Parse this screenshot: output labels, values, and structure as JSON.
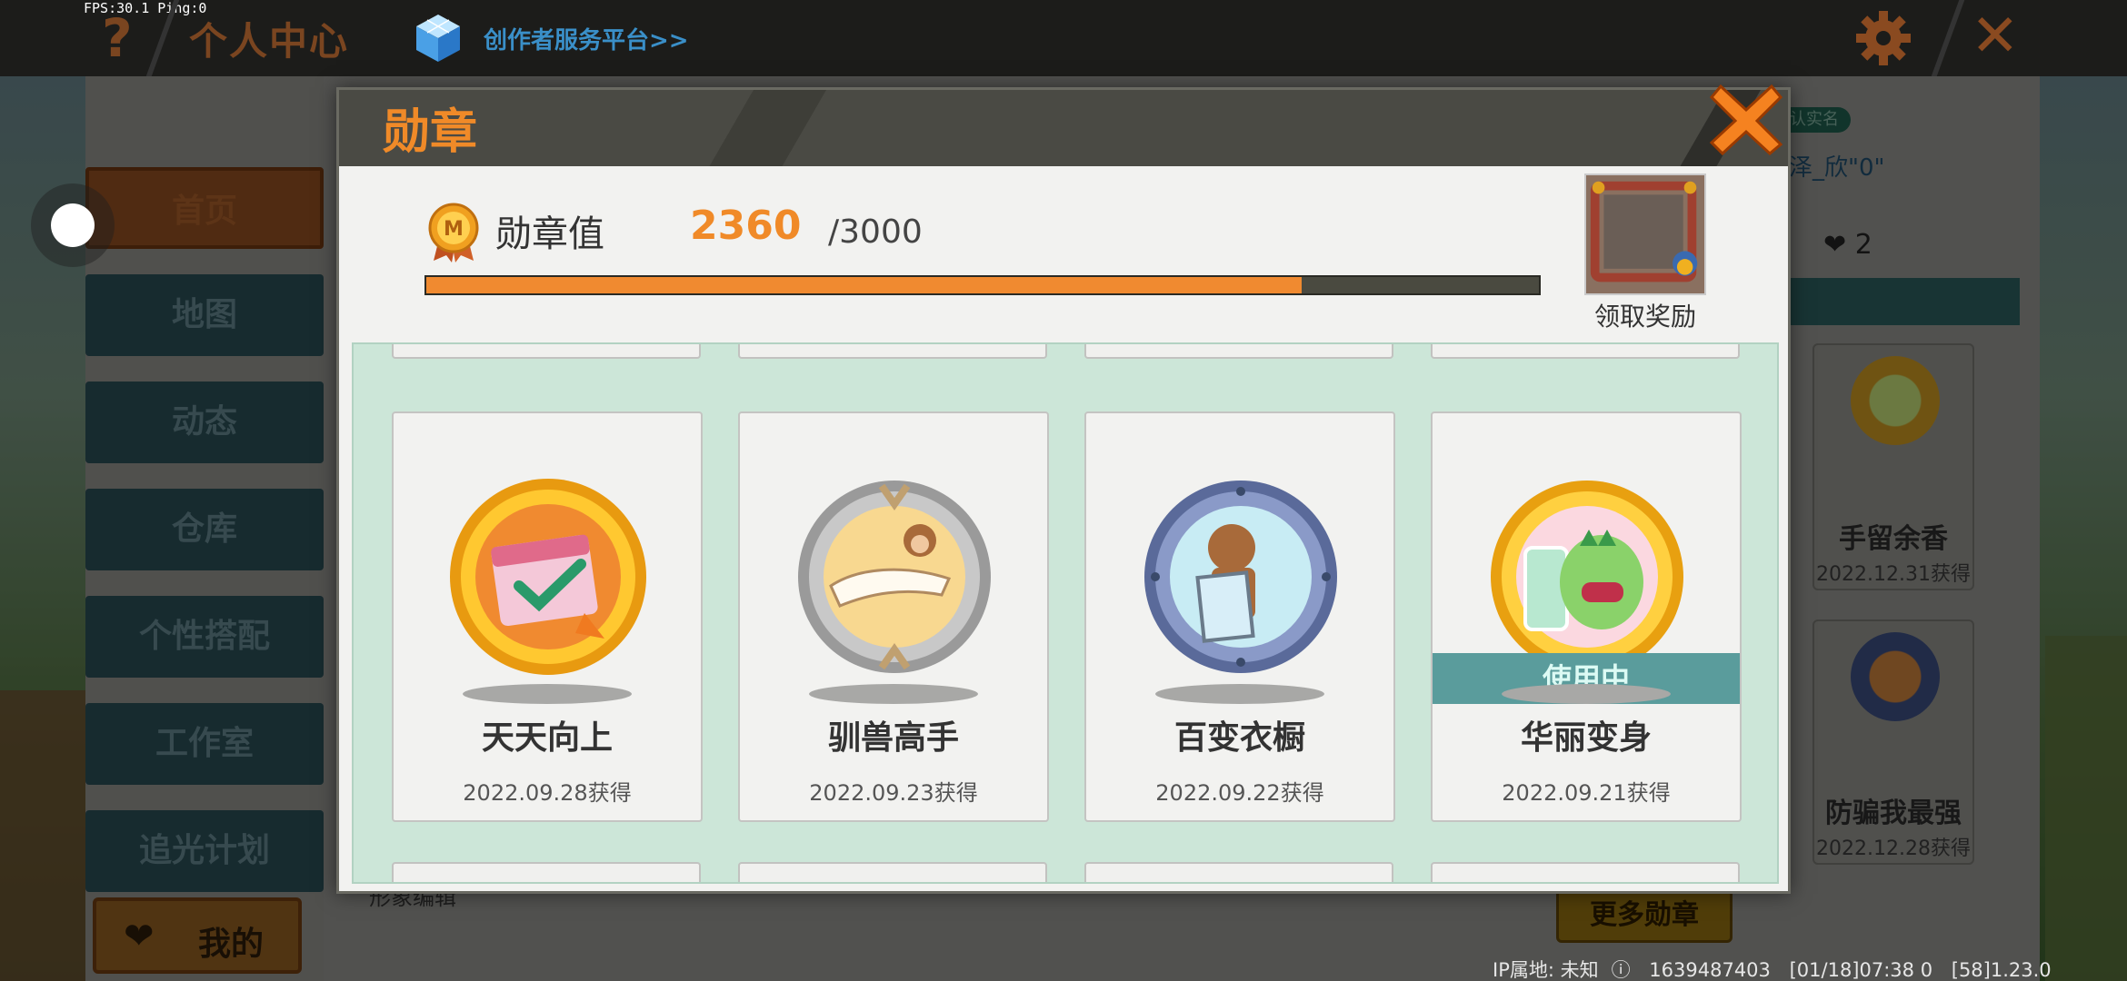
{
  "status_bar": {
    "fps": "FPS:30.1  Ping:0"
  },
  "top_bar": {
    "help_glyph": "?",
    "title": "个人中心",
    "creator_link": "创作者服务平台>>",
    "close_glyph": "✕"
  },
  "sidebar": {
    "items": [
      {
        "label": "首页"
      },
      {
        "label": "地图"
      },
      {
        "label": "动态"
      },
      {
        "label": "仓库"
      },
      {
        "label": "个性搭配"
      },
      {
        "label": "工作室"
      },
      {
        "label": "追光计划"
      }
    ],
    "mine_label": "我的"
  },
  "profile": {
    "real_name_tag": "认实名",
    "name_fragment": "泽_欣\"0\"",
    "likes": "2",
    "edit_fragment": "形象编辑",
    "more_badges": "更多勋章"
  },
  "background_badges": [
    {
      "name": "手留余香",
      "date": "2022.12.31获得"
    },
    {
      "name": "防骗我最强",
      "date": "2022.12.28获得"
    }
  ],
  "footer": {
    "ip_label": "IP属地: 未知",
    "uid": "1639487403",
    "time": "[01/18]07:38 0",
    "version": "[58]1.23.0"
  },
  "modal": {
    "title": "勋章",
    "value_label": "勋章值",
    "value_current": "2360",
    "value_max": "/3000",
    "progress": 0.787,
    "reward_label": "领取奖励",
    "in_use_label": "使用中",
    "badges": [
      {
        "name": "天天向上",
        "date": "2022.09.28获得",
        "in_use": false
      },
      {
        "name": "驯兽高手",
        "date": "2022.09.23获得",
        "in_use": false
      },
      {
        "name": "百变衣橱",
        "date": "2022.09.22获得",
        "in_use": false
      },
      {
        "name": "华丽变身",
        "date": "2022.09.21获得",
        "in_use": true
      }
    ]
  },
  "colors": {
    "accent_orange": "#f08a28",
    "in_use_teal": "#5a9c9c",
    "grid_bg": "#cce6d8"
  }
}
